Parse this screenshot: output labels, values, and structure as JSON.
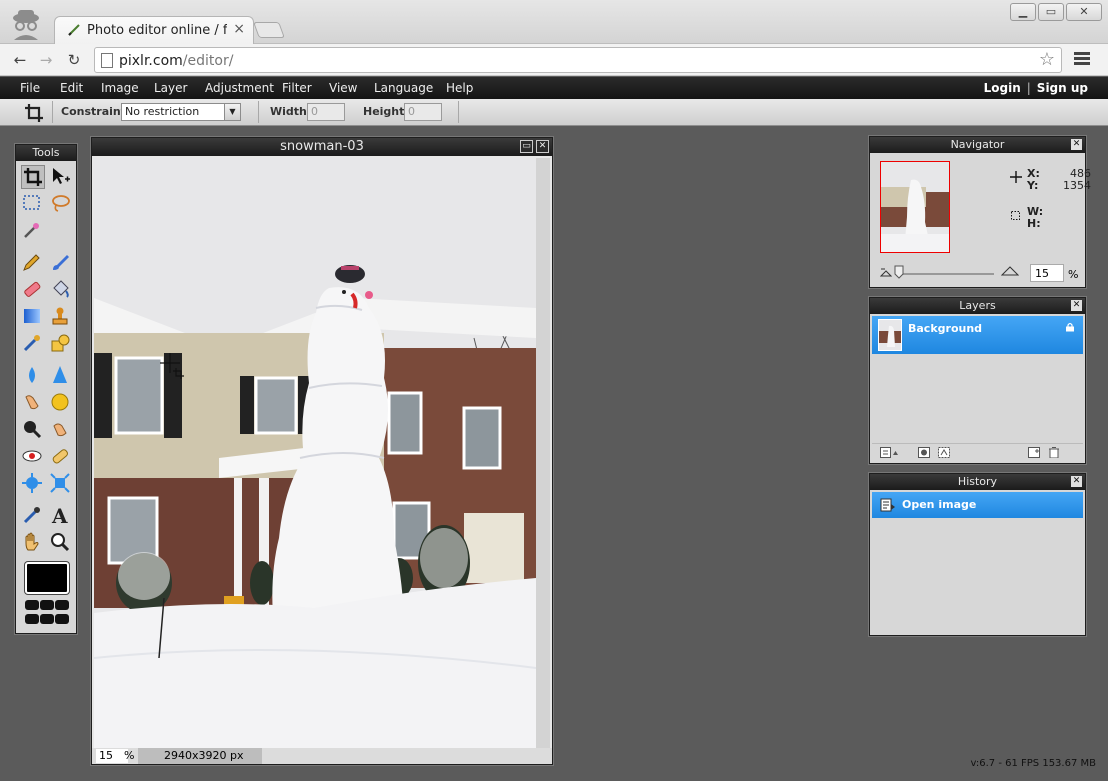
{
  "browser": {
    "tab_title": "Photo editor online / free image editing",
    "tab_close": "×",
    "url_host": "pixlr.com",
    "url_path": "/editor/",
    "win_minimize": "▁",
    "win_maximize": "▭",
    "win_close": "✕"
  },
  "menubar": {
    "items": [
      "File",
      "Edit",
      "Image",
      "Layer",
      "Adjustment",
      "Filter",
      "View",
      "Language",
      "Help"
    ],
    "login": "Login",
    "separator": "|",
    "signup": "Sign up"
  },
  "options": {
    "constraint_label": "Constraint:",
    "constraint_value": "No restriction",
    "width_label": "Width:",
    "width_value": "0",
    "height_label": "Height:",
    "height_value": "0"
  },
  "tools": {
    "title": "Tools",
    "foreground_color": "#000000"
  },
  "document": {
    "title": "snowman-03",
    "zoom": "15",
    "zoom_unit": "%",
    "dimensions": "2940x3920 px"
  },
  "navigator": {
    "title": "Navigator",
    "x_label": "X:",
    "x_value": "486",
    "y_label": "Y:",
    "y_value": "1354",
    "w_label": "W:",
    "h_label": "H:",
    "zoom": "15",
    "zoom_unit": "%"
  },
  "layers": {
    "title": "Layers",
    "items": [
      {
        "name": "Background",
        "locked": true
      }
    ]
  },
  "history": {
    "title": "History",
    "items": [
      "Open image"
    ]
  },
  "status": "v:6.7 - 61 FPS 153.67 MB",
  "colors": {
    "accent": "#2f95ea",
    "menubar": "#1b1b1b",
    "workspace": "#5b5b5b"
  }
}
